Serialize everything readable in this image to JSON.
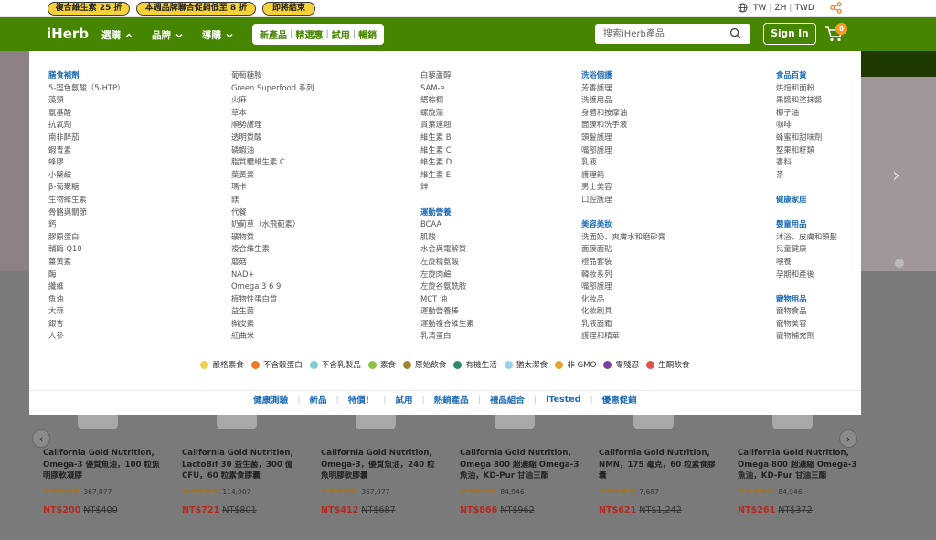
{
  "promo": {
    "pills": [
      "複合維生素 25 折",
      "本週品牌聯合促銷低至 8 折",
      "即將結束"
    ]
  },
  "locale": {
    "country": "TW",
    "language": "ZH",
    "currency": "TWD"
  },
  "header": {
    "logo": "iHerb",
    "nav": [
      "選購",
      "品牌",
      "導購"
    ],
    "quick_links": [
      "新產品",
      "精選惠",
      "試用",
      "暢銷"
    ],
    "search_placeholder": "搜索iHerb產品",
    "signin": "Sign In",
    "cart_count": "0"
  },
  "menu": {
    "col1": {
      "category": "膳食補劑",
      "items": [
        "5-羥色氨酸（5-HTP）",
        "藻類",
        "氨基酸",
        "抗氧劑",
        "南非醉茄",
        "蝦青素",
        "蜂膠",
        "小檗鹼",
        "β-葡聚糖",
        "生物維生素",
        "骨骼與關節",
        "鈣",
        "膠原蛋白",
        "輔酶 Q10",
        "薑黃素",
        "酶",
        "纖維",
        "魚油",
        "大蒜",
        "銀杏",
        "人參"
      ]
    },
    "col2": {
      "items": [
        "葡萄糖胺",
        "Green Superfood 系列",
        "火麻",
        "草本",
        "順勢護理",
        "透明質酸",
        "磷蝦油",
        "脂質體維生素 C",
        "葉黃素",
        "瑪卡",
        "鎂",
        "代餐",
        "奶薊草（水飛薊素）",
        "礦物質",
        "複合維生素",
        "蘑菇",
        "NAD+",
        "Omega 3 6 9",
        "植物性蛋白質",
        "益生菌",
        "槲皮素",
        "紅曲米"
      ]
    },
    "col3": {
      "items": [
        "白藜蘆醇",
        "SAM-e",
        "鋸棕櫚",
        "螺旋藻",
        "貫葉連翹",
        "維生素 B",
        "維生素 C",
        "維生素 D",
        "維生素 E",
        "鋅"
      ],
      "category2": "運動營養",
      "items2": [
        "BCAA",
        "肌酸",
        "水合與電解質",
        "左旋精氨酸",
        "左旋肉鹼",
        "左旋谷氨酰胺",
        "MCT 油",
        "運動營養棒",
        "運動複合維生素",
        "乳清蛋白"
      ]
    },
    "col4": {
      "category": "洗浴個護",
      "items": [
        "芳香護理",
        "洗護用品",
        "身體和按摩油",
        "面膜和洗手液",
        "頭髮護理",
        "嘴部護理",
        "乳液",
        "護理箱",
        "男士美容",
        "口腔護理"
      ],
      "category2": "美容美妝",
      "items2": [
        "洗面奶、爽膚水和磨砂膏",
        "面膜面貼",
        "禮品套裝",
        "韓妝系列",
        "嘴部護理",
        "化妝品",
        "化妝刷具",
        "乳液面霜",
        "護理和精華"
      ]
    },
    "col5": {
      "category": "食品百貨",
      "items": [
        "烘焙和面粉",
        "果醬和塗抹醬",
        "椰子油",
        "咖啡",
        "蜂蜜和甜味劑",
        "堅果和籽類",
        "香料",
        "茶"
      ],
      "category2": "健康家居",
      "category3": "嬰童用品",
      "items3": [
        "沐浴、皮膚和頭髮",
        "兒童健康",
        "喂養",
        "孕期和產後"
      ],
      "category4": "寵物用品",
      "items4": [
        "寵物食品",
        "寵物美容",
        "寵物補充劑"
      ]
    }
  },
  "legend": [
    {
      "label": "嚴格素食",
      "color": "#f2cf4a"
    },
    {
      "label": "不含穀蛋白",
      "color": "#f07a1f"
    },
    {
      "label": "不含乳製品",
      "color": "#7ecbd6"
    },
    {
      "label": "素食",
      "color": "#8cc43f"
    },
    {
      "label": "原始飲食",
      "color": "#a08431"
    },
    {
      "label": "有機生活",
      "color": "#2e8b6e"
    },
    {
      "label": "猶太潔食",
      "color": "#9fd0e6"
    },
    {
      "label": "非 GMO",
      "color": "#e0a52c"
    },
    {
      "label": "零殘忍",
      "color": "#7b3fa0"
    },
    {
      "label": "生酮飲食",
      "color": "#e2524a"
    }
  ],
  "bottom_links": [
    "健康測驗",
    "新品",
    "特價！",
    "試用",
    "熱銷產品",
    "禮品組合",
    "iTested",
    "優惠促銷"
  ],
  "products": [
    {
      "title": "California Gold Nutrition, Omega-3 優質魚油，100 粒魚明膠軟凝膠",
      "reviews": "367,077",
      "rating": 4.5,
      "price": "NT$200",
      "was": "NT$400"
    },
    {
      "title": "California Gold Nutrition, LactoBif 30 益生菌，300 億 CFU，60 粒素食膠囊",
      "reviews": "114,907",
      "rating": 4.5,
      "price": "NT$721",
      "was": "NT$801"
    },
    {
      "title": "California Gold Nutrition, Omega-3，優質魚油，240 粒魚明膠軟膠囊",
      "reviews": "367,077",
      "rating": 4.5,
      "price": "NT$412",
      "was": "NT$687"
    },
    {
      "title": "California Gold Nutrition, Omega 800 超濃縮 Omega-3 魚油，KD-Pur 甘油三酯",
      "reviews": "84,946",
      "rating": 4.5,
      "price": "NT$866",
      "was": "NT$962"
    },
    {
      "title": "California Gold Nutrition, NMN，175 毫克，60 粒素食膠囊",
      "reviews": "7,687",
      "rating": 4.5,
      "price": "NT$621",
      "was": "NT$1,242"
    },
    {
      "title": "California Gold Nutrition, Omega 800 超濃縮 Omega-3 魚油，KD-Pur 甘油三酯",
      "reviews": "84,946",
      "rating": 4.5,
      "price": "NT$261",
      "was": "NT$372"
    }
  ]
}
